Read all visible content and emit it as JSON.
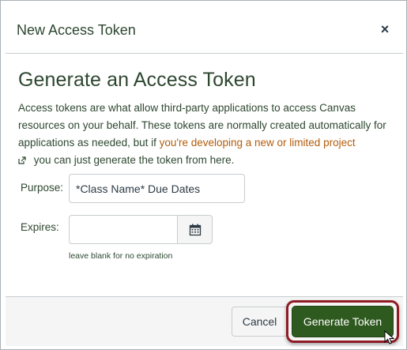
{
  "dialog": {
    "title": "New Access Token",
    "close_label": "×"
  },
  "body": {
    "heading": "Generate an Access Token",
    "description_part1": "Access tokens are what allow third-party applications to access Canvas resources on your behalf. These tokens are normally created automatically for applications as needed, but if ",
    "description_link": "you're developing a new or limited project",
    "description_part2": " you can just generate the token from here."
  },
  "form": {
    "purpose_label": "Purpose:",
    "purpose_value": "*Class Name* Due Dates",
    "expires_label": "Expires:",
    "expires_value": "",
    "expires_hint": "leave blank for no expiration"
  },
  "footer": {
    "cancel_label": "Cancel",
    "generate_label": "Generate Token"
  },
  "icons": {
    "close": "close-icon",
    "external_link": "external-link-icon",
    "calendar": "calendar-icon",
    "cursor": "mouse-pointer-icon"
  },
  "colors": {
    "heading": "#2e4730",
    "link": "#b35c0b",
    "primary_button": "#2f5a1f",
    "highlight": "#8f1c24"
  }
}
